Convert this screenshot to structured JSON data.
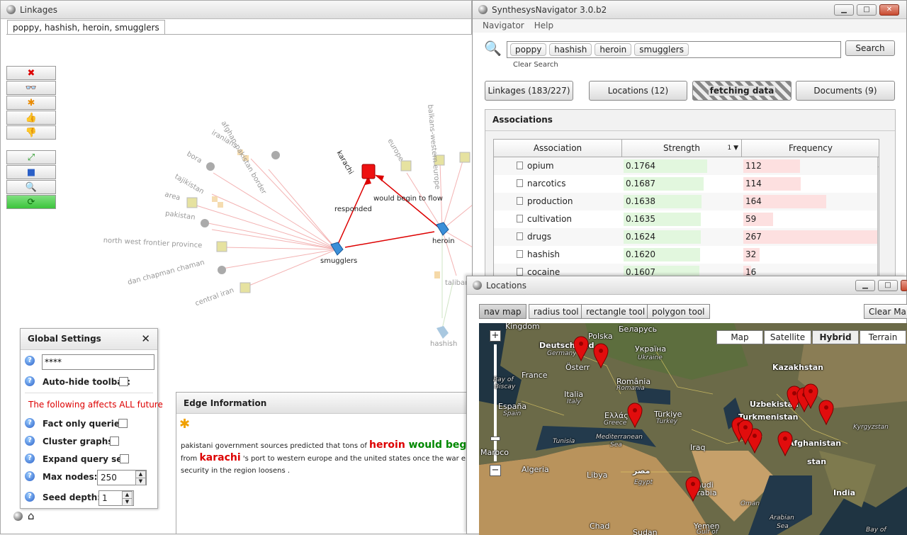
{
  "linkages": {
    "title": "Linkages",
    "tab": "poppy, hashish, heroin, smugglers",
    "graph": {
      "nodes": {
        "karachi": "karachi",
        "heroin": "heroin",
        "smugglers": "smugglers",
        "hashish": "hashish"
      },
      "edges": {
        "responded": "responded",
        "would_begin": "would begin to flow"
      },
      "faded": [
        "afghan-pakistan border",
        "iranians",
        "bora",
        "tajikistan",
        "area",
        "pakistan",
        "north west frontier province",
        "dan chapman chaman",
        "central iran",
        "europe",
        "balkans-western europe",
        "taliban"
      ]
    }
  },
  "global_settings": {
    "title": "Global Settings",
    "password_value": "****",
    "auto_hide": "Auto-hide toolbar:",
    "warning": "The following affects ALL future",
    "fact_only": "Fact only queries:",
    "cluster": "Cluster graphs:",
    "expand": "Expand query set:",
    "max_nodes_label": "Max nodes:",
    "max_nodes": "250",
    "seed_depth_label": "Seed depth:",
    "seed_depth": "1"
  },
  "edge_info": {
    "title": "Edge Information",
    "t1": "pakistani government sources predicted that tons of ",
    "h1": "heroin",
    "h2": " would begin to f",
    "t2": "from ",
    "h3": "karachi",
    "t3": " 's port to western europe and the united states once the war ends and",
    "t4": "security in the region loosens ."
  },
  "synth": {
    "title": "SynthesysNavigator 3.0.b2",
    "menu": [
      "Navigator",
      "Help"
    ],
    "chips": [
      "poppy",
      "hashish",
      "heroin",
      "smugglers"
    ],
    "search_btn": "Search",
    "clear": "Clear Search",
    "tabs": [
      "Linkages (183/227)",
      "Locations (12)",
      "fetching data",
      "Documents (9)"
    ],
    "assoc_title": "Associations",
    "columns": [
      "Association",
      "Strength",
      "Frequency"
    ],
    "sort_indicator": "1 ▼",
    "rows": [
      {
        "name": "opium",
        "strength": "0.1764",
        "freq": "112",
        "s": 0.1764,
        "f": 112
      },
      {
        "name": "narcotics",
        "strength": "0.1687",
        "freq": "114",
        "s": 0.1687,
        "f": 114
      },
      {
        "name": "production",
        "strength": "0.1638",
        "freq": "164",
        "s": 0.1638,
        "f": 164
      },
      {
        "name": "cultivation",
        "strength": "0.1635",
        "freq": "59",
        "s": 0.1635,
        "f": 59
      },
      {
        "name": "drugs",
        "strength": "0.1624",
        "freq": "267",
        "s": 0.1624,
        "f": 267
      },
      {
        "name": "hashish",
        "strength": "0.1620",
        "freq": "32",
        "s": 0.162,
        "f": 32
      },
      {
        "name": "cocaine",
        "strength": "0.1607",
        "freq": "16",
        "s": 0.1607,
        "f": 16
      }
    ]
  },
  "locations": {
    "title": "Locations",
    "tools": [
      "nav map",
      "radius tool",
      "rectangle tool",
      "polygon tool"
    ],
    "clear_map": "Clear Map",
    "map_types": [
      "Map",
      "Satellite",
      "Hybrid",
      "Terrain"
    ],
    "labels": {
      "kingdom": "Kingdom",
      "polska": "Polska",
      "belarus": "Беларусь",
      "deutschland": "Deutschland",
      "germany": "Germany",
      "ukraine": "Україна",
      "ukraine_en": "Ukraine",
      "kazakhstan": "Kazakhstan",
      "france": "France",
      "osterreich": "Österr",
      "romania": "România",
      "romania_en": "Romania",
      "bay_of": "Bay of",
      "biscay": "Biscay",
      "italia": "Italia",
      "italy": "Italy",
      "uzbekistan": "Uzbekistan",
      "espana": "España",
      "spain": "Spain",
      "ellas": "Ελλάς",
      "greece": "Greece",
      "turkiye": "Türkiye",
      "turkey": "Turkey",
      "turkmenistan": "Turkmenistan",
      "kyrgyzstan": "Kyrgyzstan",
      "tunisia": "Tunisia",
      "mediterranean": "Mediterranean",
      "sea": "Sea",
      "afghanistan": "Afghanistan",
      "marocco": "Maroco",
      "iraq": "Iraq",
      "stan": "stan",
      "algeria": "Algeria",
      "libya": "Libya",
      "misr": "مصر",
      "egypt": "Egypt",
      "saudi": "Saudi",
      "arabia": "Arabia",
      "india": "India",
      "oman": "Oman",
      "arabian": "Arabian",
      "sea2": "Sea",
      "chad": "Chad",
      "sudan": "Sudan",
      "yemen": "Yemen",
      "gulf": "Gulf of",
      "bay_of2": "Bay of"
    }
  }
}
